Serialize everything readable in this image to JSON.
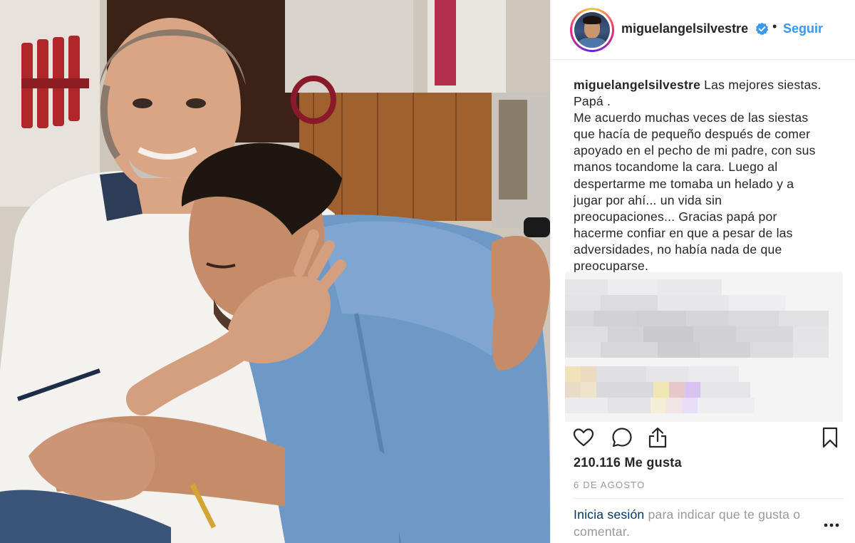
{
  "post": {
    "photo_alt": "",
    "username": "miguelangelsilvestre",
    "verified_icon": "verified-badge-icon",
    "separator": "•",
    "follow_label": "Seguir",
    "caption_lines": [
      "Las mejores siestas.",
      "Papá .",
      "Me acuerdo muchas veces de las siestas",
      "que hacía de pequeño después de comer",
      "apoyado en el pecho de mi padre, con sus",
      "manos tocandome la cara. Luego al",
      "despertarme me tomaba un helado y a",
      "jugar por ahí... un vida sin",
      "preocupaciones... Gracias papá por",
      "hacerme confiar en que a pesar de las",
      "adversidades, no había nada de que",
      "preocuparse."
    ],
    "likes": "210.116 Me gusta",
    "date": "6 DE AGOSTO",
    "login_link": "Inicia sesión",
    "login_text": " para indicar que te gusta o comentar."
  },
  "icons": {
    "like": "heart-icon",
    "comment": "comment-icon",
    "share": "share-icon",
    "save": "bookmark-icon",
    "more": "more-options-icon"
  },
  "colors": {
    "link_blue": "#3897f0",
    "login_blue": "#003569",
    "text": "#262626",
    "muted": "#999999"
  }
}
